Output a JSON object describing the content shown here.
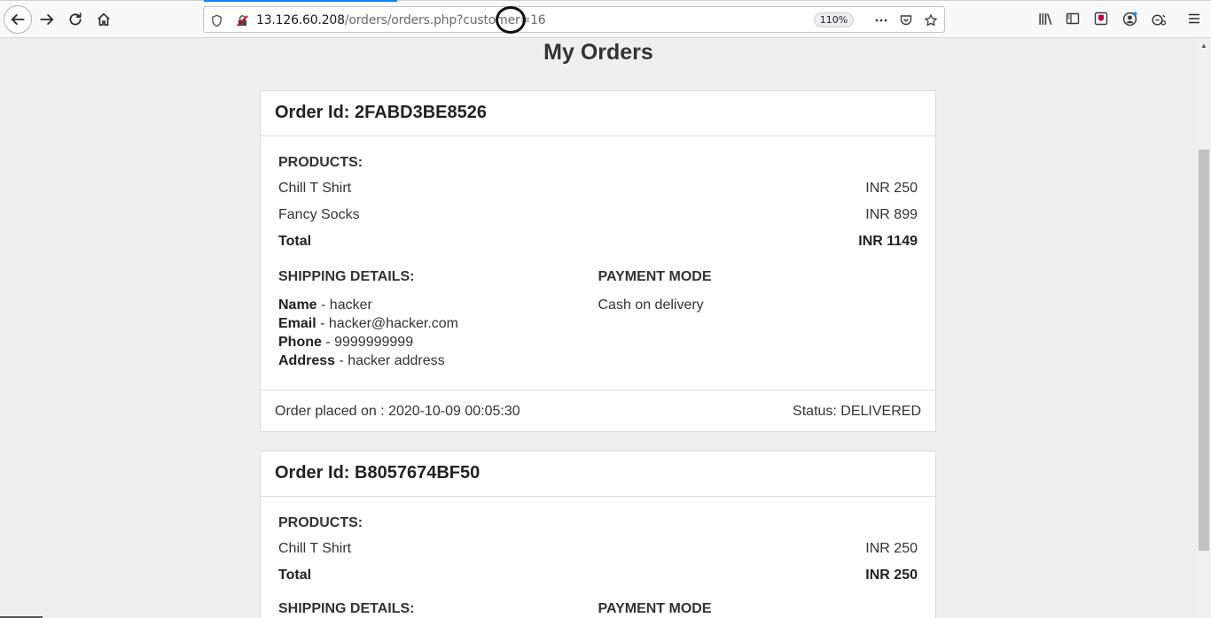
{
  "browser": {
    "url_host": "13.126.60.208",
    "url_path": "/orders/orders.php?customer=16",
    "zoom": "110%",
    "icons": [
      "back-icon",
      "forward-icon",
      "reload-icon",
      "home-icon",
      "shield-icon",
      "insecure-lock-icon",
      "more-icon",
      "pocket-icon",
      "bookmark-star-icon",
      "library-icon",
      "sidebar-icon",
      "extension-icon",
      "account-icon",
      "sync-icon",
      "menu-icon"
    ]
  },
  "page": {
    "title": "My Orders"
  },
  "orders": [
    {
      "order_id": "Order Id: 2FABD3BE8526",
      "products_label": "PRODUCTS:",
      "items": [
        {
          "name": "Chill T Shirt",
          "price": "INR 250"
        },
        {
          "name": "Fancy Socks",
          "price": "INR 899"
        }
      ],
      "total_label": "Total",
      "total_value": "INR 1149",
      "shipping_label": "SHIPPING DETAILS:",
      "name_label": "Name",
      "name_value": " - hacker",
      "email_label": "Email",
      "email_value": " - hacker@hacker.com",
      "phone_label": "Phone",
      "phone_value": " - 9999999999",
      "address_label": "Address",
      "address_value": " - hacker address",
      "payment_label": "PAYMENT MODE",
      "payment_value": "Cash on delivery",
      "placed_on": "Order placed on : 2020-10-09 00:05:30",
      "status": "Status: DELIVERED"
    },
    {
      "order_id": "Order Id: B8057674BF50",
      "products_label": "PRODUCTS:",
      "items": [
        {
          "name": "Chill T Shirt",
          "price": "INR 250"
        }
      ],
      "total_label": "Total",
      "total_value": "INR 250",
      "shipping_label": "SHIPPING DETAILS:",
      "payment_label": "PAYMENT MODE"
    }
  ]
}
